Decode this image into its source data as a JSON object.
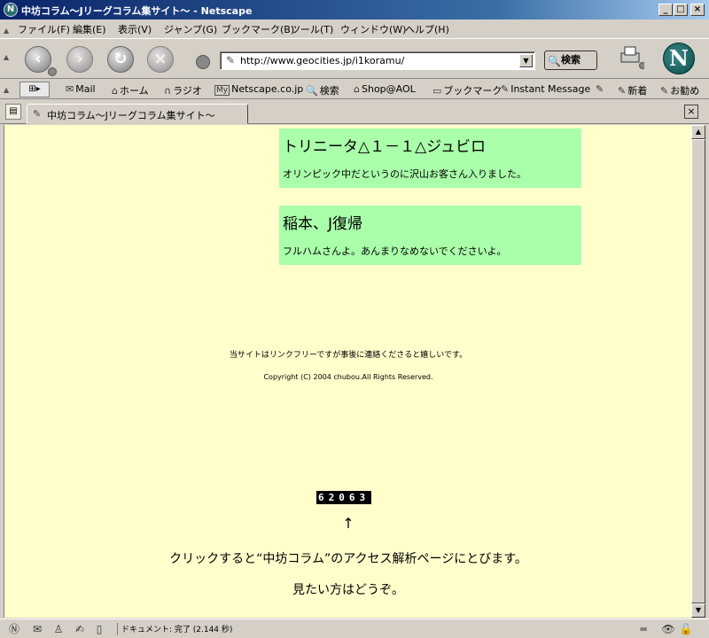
{
  "window": {
    "title": "中坊コラム～Jリーグコラム集サイト～ - Netscape",
    "app_icon_letter": "N"
  },
  "menu": {
    "items": [
      "ファイル(F)",
      "編集(E)",
      "表示(V)",
      "ジャンプ(G)",
      "ブックマーク(B)",
      "ツール(T)",
      "ウィンドウ(W)",
      "ヘルプ(H)"
    ]
  },
  "navigation": {
    "url": "http://www.geocities.jp/i1koramu/",
    "search_label": "検索",
    "logo_letter": "N"
  },
  "personal_toolbar": {
    "items": [
      "Mail",
      "ホーム",
      "ラジオ",
      "Netscape.co.jp",
      "検索",
      "Shop@AOL",
      "ブックマーク",
      "Instant Message",
      "新着",
      "お勧め"
    ],
    "my_label": "My"
  },
  "tab": {
    "title": "中坊コラム～Jリーグコラム集サイト～"
  },
  "content": {
    "news": [
      {
        "title": "トリニータ△１－１△ジュビロ",
        "body": "オリンピック中だというのに沢山お客さん入りました。"
      },
      {
        "title": "稲本、J復帰",
        "body": "フルハムさんよ。あんまりなめないでくださいよ。"
      }
    ],
    "link_free": "当サイトはリンクフリーですが事後に連絡くださると嬉しいです。",
    "copyright": "Copyright (C) 2004 chubou.All Rights Reserved.",
    "counter": "62063",
    "arrow": "↑",
    "click_text": "クリックすると“中坊コラム”のアクセス解析ページにとびます。",
    "welcome": "見たい方はどうぞ。"
  },
  "status": {
    "text": "ドキュメント: 完了 (2.144 秒)"
  },
  "colors": {
    "page_background": "#ffffcc",
    "news_box": "#aaffaa",
    "chrome": "#d4d0c8",
    "title_bar": "#0a246a"
  }
}
